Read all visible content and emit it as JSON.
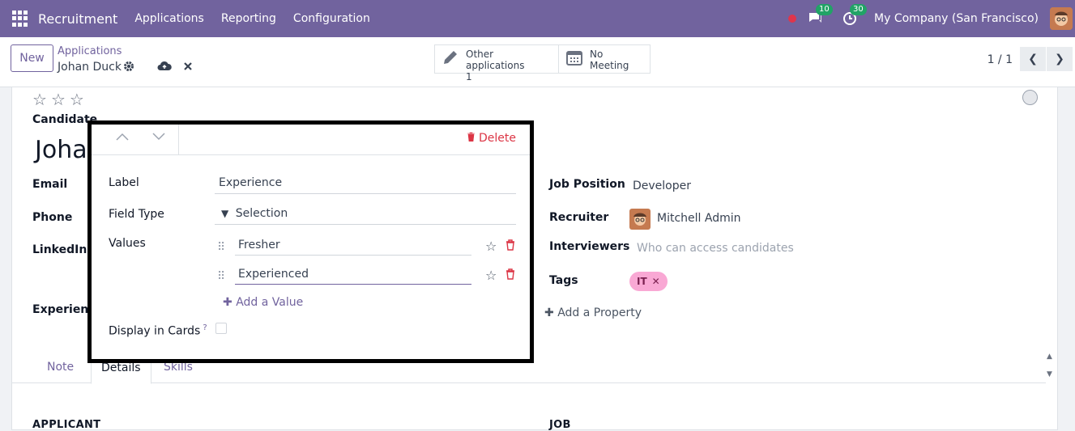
{
  "navbar": {
    "brand": "Recruitment",
    "menu": [
      "Applications",
      "Reporting",
      "Configuration"
    ],
    "messages_count": "10",
    "activities_count": "30",
    "company": "My Company (San Francisco)",
    "bg_color": "#71639e"
  },
  "control": {
    "new_label": "New",
    "breadcrumb_parent": "Applications",
    "breadcrumb_current": "Johan Duck",
    "other_applications_label": "Other applications",
    "other_applications_count": "1",
    "meeting_label": "No Meeting",
    "pager": "1 / 1"
  },
  "form": {
    "candidate_label": "Candidate",
    "candidate_name": "Johan",
    "email_label": "Email",
    "phone_label": "Phone",
    "linkedin_label": "LinkedIn Pr",
    "experience_label": "Experience",
    "job_position_label": "Job Position",
    "job_position_value": "Developer",
    "recruiter_label": "Recruiter",
    "recruiter_value": "Mitchell Admin",
    "interviewers_label": "Interviewers",
    "interviewers_placeholder": "Who can access candidates",
    "tags_label": "Tags",
    "tag_it": "IT",
    "add_property": "Add a Property",
    "tabs": [
      "Note",
      "Details",
      "Skills"
    ],
    "section_applicant": "APPLICANT",
    "section_job": "JOB"
  },
  "popover": {
    "delete_label": "Delete",
    "label_label": "Label",
    "label_value": "Experience",
    "field_type_label": "Field Type",
    "field_type_value": "Selection",
    "values_label": "Values",
    "values": [
      "Fresher",
      "Experienced"
    ],
    "add_value": "Add a Value",
    "display_in_cards_label": "Display in Cards",
    "help_mark": "?"
  },
  "colors": {
    "accent": "#71639e",
    "danger": "#dc3545",
    "tag_bg": "#f9a8d4"
  }
}
